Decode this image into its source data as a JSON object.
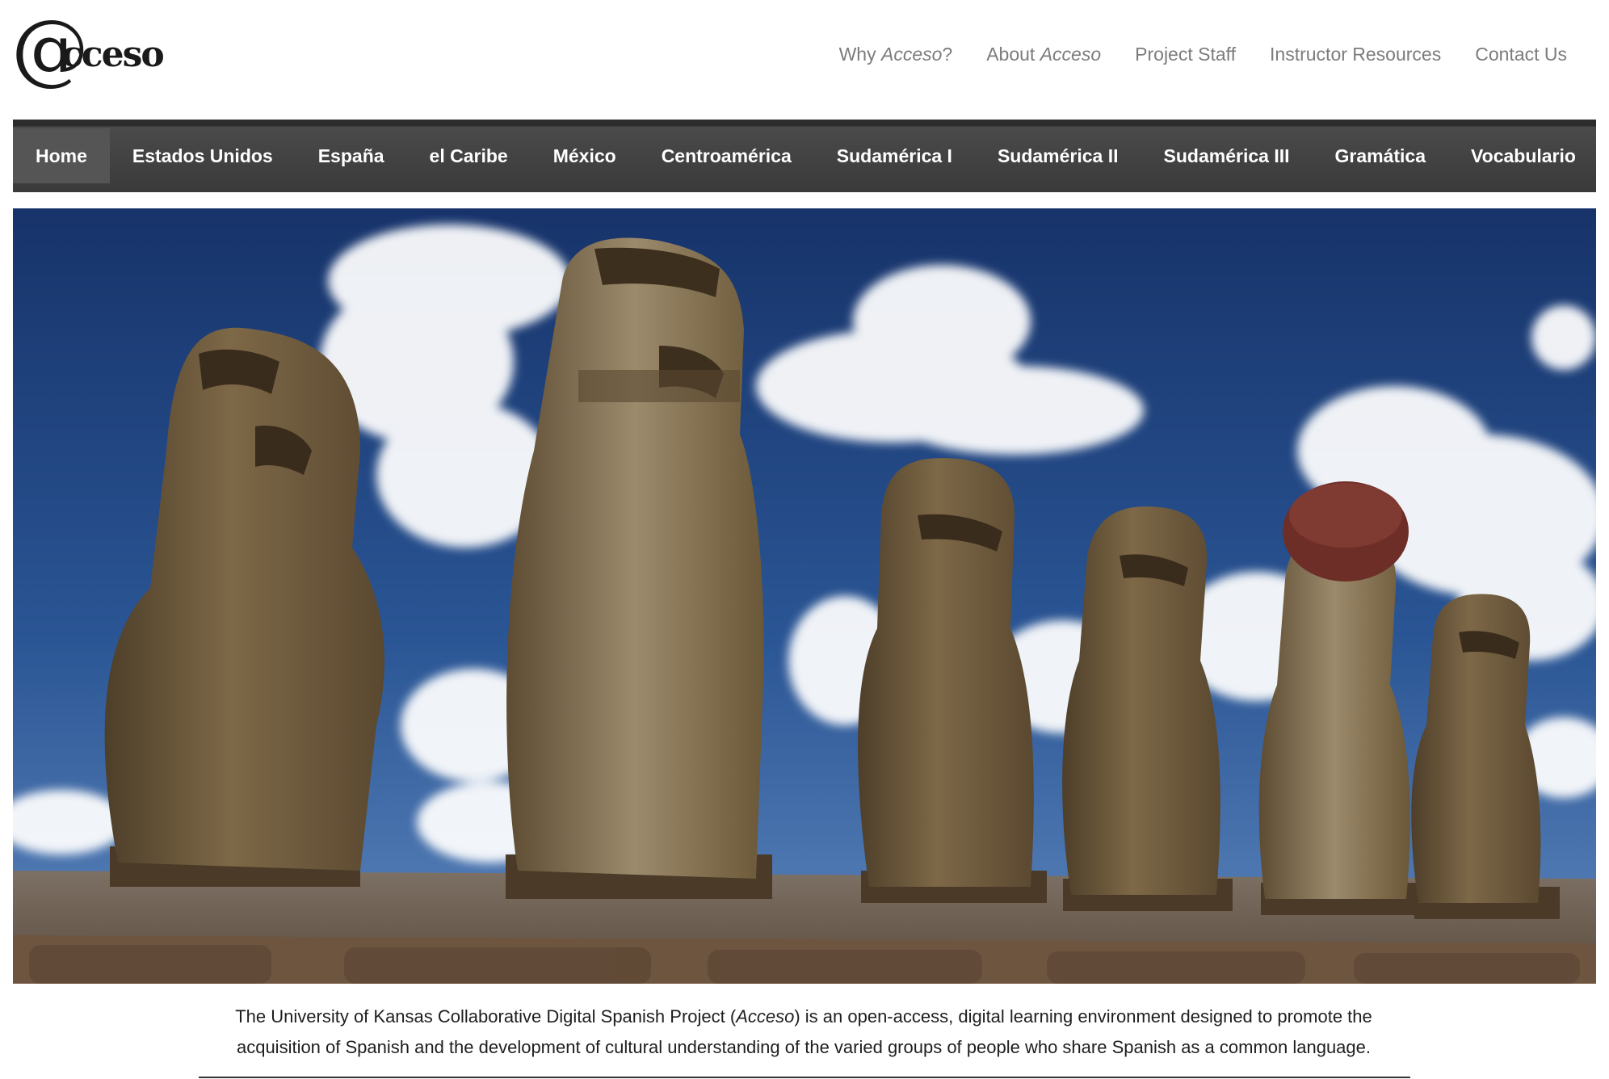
{
  "logo": {
    "symbol": "@",
    "text": "cceso"
  },
  "top_nav": [
    {
      "prefix": "Why ",
      "emph": "Acceso",
      "suffix": "?"
    },
    {
      "prefix": "About ",
      "emph": "Acceso",
      "suffix": ""
    },
    {
      "prefix": "Project Staff",
      "emph": "",
      "suffix": ""
    },
    {
      "prefix": "Instructor Resources",
      "emph": "",
      "suffix": ""
    },
    {
      "prefix": "Contact Us",
      "emph": "",
      "suffix": ""
    }
  ],
  "main_nav": [
    {
      "label": "Home",
      "active": true
    },
    {
      "label": "Estados Unidos",
      "active": false
    },
    {
      "label": "España",
      "active": false
    },
    {
      "label": "el Caribe",
      "active": false
    },
    {
      "label": "México",
      "active": false
    },
    {
      "label": "Centroamérica",
      "active": false
    },
    {
      "label": "Sudamérica I",
      "active": false
    },
    {
      "label": "Sudamérica II",
      "active": false
    },
    {
      "label": "Sudamérica III",
      "active": false
    },
    {
      "label": "Gramática",
      "active": false
    },
    {
      "label": "Vocabulario",
      "active": false
    }
  ],
  "hero": {
    "subject": "moai-statues-photo"
  },
  "intro": {
    "before": "The University of Kansas Collaborative Digital Spanish Project (",
    "emph": "Acceso",
    "after": ") is an open-access, digital learning environment designed to promote the acquisition of Spanish and the development of cultural understanding of the varied groups of people who share Spanish as a common language."
  },
  "colors": {
    "nav_bg": "#3a3a3a",
    "nav_active": "#555555",
    "top_link": "#7c7c7c",
    "sky": "#1e3f7a",
    "stone": "#6b5a3e"
  }
}
